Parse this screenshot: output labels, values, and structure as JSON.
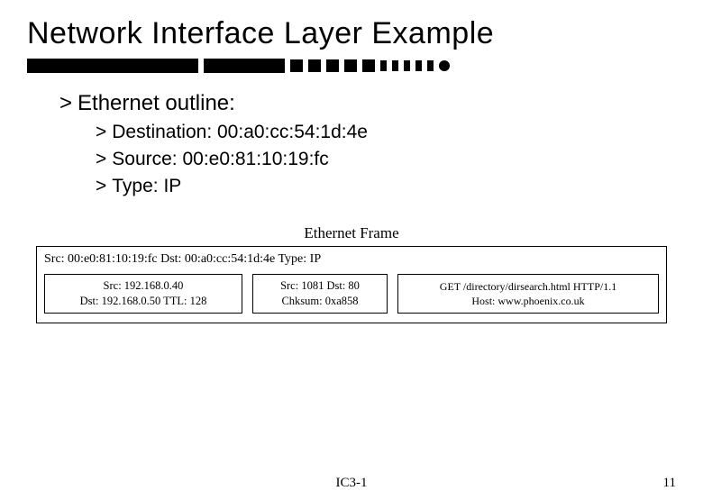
{
  "title": "Network Interface Layer Example",
  "outline": {
    "heading": "Ethernet outline:",
    "items": [
      "Destination: 00:a0:cc:54:1d:4e",
      "Source: 00:e0:81:10:19:fc",
      "Type: IP"
    ]
  },
  "frame": {
    "label": "Ethernet Frame",
    "ethernet_line": "Src: 00:e0:81:10:19:fc Dst: 00:a0:cc:54:1d:4e Type: IP",
    "ip": {
      "line1": "Src: 192.168.0.40",
      "line2": "Dst: 192.168.0.50 TTL: 128"
    },
    "tcp": {
      "line1": "Src: 1081 Dst: 80",
      "line2": "Chksum: 0xa858"
    },
    "http": {
      "line1": "GET /directory/dirsearch.html HTTP/1.1",
      "line2": "Host: www.phoenix.co.uk"
    }
  },
  "footer": {
    "center": "IC3-1",
    "page": "11"
  }
}
